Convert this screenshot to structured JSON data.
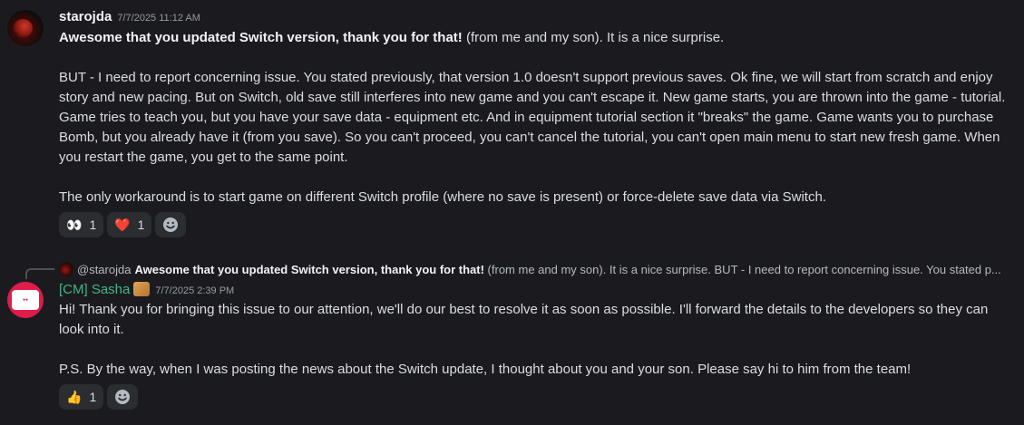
{
  "messages": [
    {
      "author": "starojda",
      "timestamp": "7/7/2025 11:12 AM",
      "line1_bold": "Awesome that you updated Switch version, thank you for that!",
      "line1_rest": " (from me and my son). It is a nice surprise.",
      "paragraph2": "BUT - I need to report concerning issue. You stated previously, that version 1.0 doesn't support previous saves. Ok fine, we will start from scratch and enjoy story and new pacing. But on Switch, old save still interferes into new game and you can't escape it. New game starts, you are thrown into the game - tutorial. Game tries to teach you, but you have your save data - equipment etc. And in equipment tutorial section it \"breaks\" the game. Game wants you to purchase Bomb, but you already have it (from you save). So you can't proceed, you can't cancel the tutorial, you can't open main menu to start new fresh game. When you restart the game, you get to the same point.",
      "paragraph3": "The only workaround is to start game on different Switch profile (where no save is present) or force-delete save data via Switch.",
      "reactions": [
        {
          "emoji": "👀",
          "count": "1"
        },
        {
          "emoji": "❤️",
          "count": "1"
        }
      ]
    },
    {
      "reply": {
        "mention": "@starojda",
        "bold": "Awesome that you updated Switch version, thank you for that!",
        "rest": " (from me and my son). It is a nice surprise.  BUT - I need to report concerning issue. You stated p..."
      },
      "author": "[CM] Sasha",
      "timestamp": "7/7/2025 2:39 PM",
      "paragraph1": "Hi! Thank you for bringing this issue to our attention, we'll do our best to resolve it as soon as possible. I'll forward the details to the developers so they can look into it.",
      "paragraph2": "P.S. By the way, when I was posting the news about the Switch update, I thought about you and your son. Please say hi to him from the team!",
      "reactions": [
        {
          "emoji": "👍",
          "count": "1"
        }
      ]
    }
  ],
  "colors": {
    "background": "#1b1b1f",
    "mod_name": "#43b581",
    "reaction_bg": "#2b2d31"
  },
  "icons": {
    "add_reaction": "smiley-icon"
  }
}
